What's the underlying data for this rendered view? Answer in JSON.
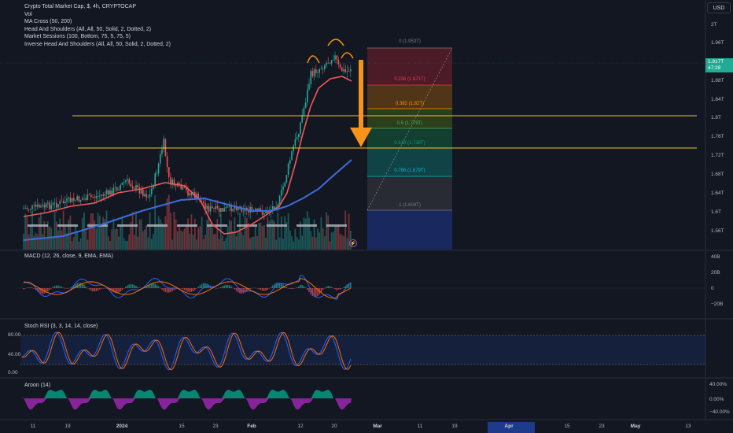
{
  "header": {
    "symbol_title": "Crypto Total Market Cap, $, 4h, CRYPTOCAP",
    "currency": "USD"
  },
  "legend": [
    "Vol",
    "MA Cross (50, 200)",
    "Head And Shoulders (All, All, 50, Solid, 2, Dotted, 2)",
    "Market Sessions (100, Bottom, 75, 5, 75, 5)",
    "Inverse Head And Shoulders (All, All, 50, Solid, 2, Dotted, 2)"
  ],
  "price_axis": {
    "ticks": [
      "2T",
      "1.96T",
      "1.92T",
      "1.88T",
      "1.84T",
      "1.8T",
      "1.76T",
      "1.72T",
      "1.68T",
      "1.64T",
      "1.6T",
      "1.56T"
    ],
    "current_price": "1.917T",
    "countdown": "47:28"
  },
  "fib_levels": [
    {
      "label": "0 (1.953T)",
      "color": "#787b86"
    },
    {
      "label": "0.236 (1.871T)",
      "color": "#f23645"
    },
    {
      "label": "0.382 (1.82T)",
      "color": "#ff9800"
    },
    {
      "label": "0.5 (1.779T)",
      "color": "#4caf50"
    },
    {
      "label": "0.618 (1.738T)",
      "color": "#089981"
    },
    {
      "label": "0.786 (1.679T)",
      "color": "#00bcd4"
    },
    {
      "label": "1 (1.604T)",
      "color": "#787b86"
    }
  ],
  "macd": {
    "title": "MACD (12, 26, close, 9, EMA, EMA)",
    "ticks": [
      "40B",
      "20B",
      "0",
      "−20B"
    ]
  },
  "stoch": {
    "title": "Stoch RSI (3, 3, 14, 14, close)",
    "ticks": [
      "80.00",
      "40.00",
      "0.00"
    ]
  },
  "aroon": {
    "title": "Aroon (14)",
    "ticks": [
      "40.00%",
      "0.00%",
      "−40.00%"
    ]
  },
  "time_axis": [
    {
      "label": "11",
      "bold": false
    },
    {
      "label": "19",
      "bold": false
    },
    {
      "label": "2024",
      "bold": true
    },
    {
      "label": "15",
      "bold": false
    },
    {
      "label": "23",
      "bold": false
    },
    {
      "label": "Feb",
      "bold": true
    },
    {
      "label": "12",
      "bold": false
    },
    {
      "label": "20",
      "bold": false
    },
    {
      "label": "Mar",
      "bold": true
    },
    {
      "label": "11",
      "bold": false
    },
    {
      "label": "19",
      "bold": false
    },
    {
      "label": "Apr",
      "bold": true
    },
    {
      "label": "15",
      "bold": false
    },
    {
      "label": "23",
      "bold": false
    },
    {
      "label": "May",
      "bold": true
    },
    {
      "label": "13",
      "bold": false
    }
  ],
  "colors": {
    "background": "#131722",
    "up": "#26a69a",
    "down": "#ef5350",
    "ma_fast": "#f05757",
    "ma_slow": "#3d6ddb",
    "horizontal_line": "#f5c518",
    "arrow": "#f7931a",
    "head_shoulders": "#f7931a"
  }
}
